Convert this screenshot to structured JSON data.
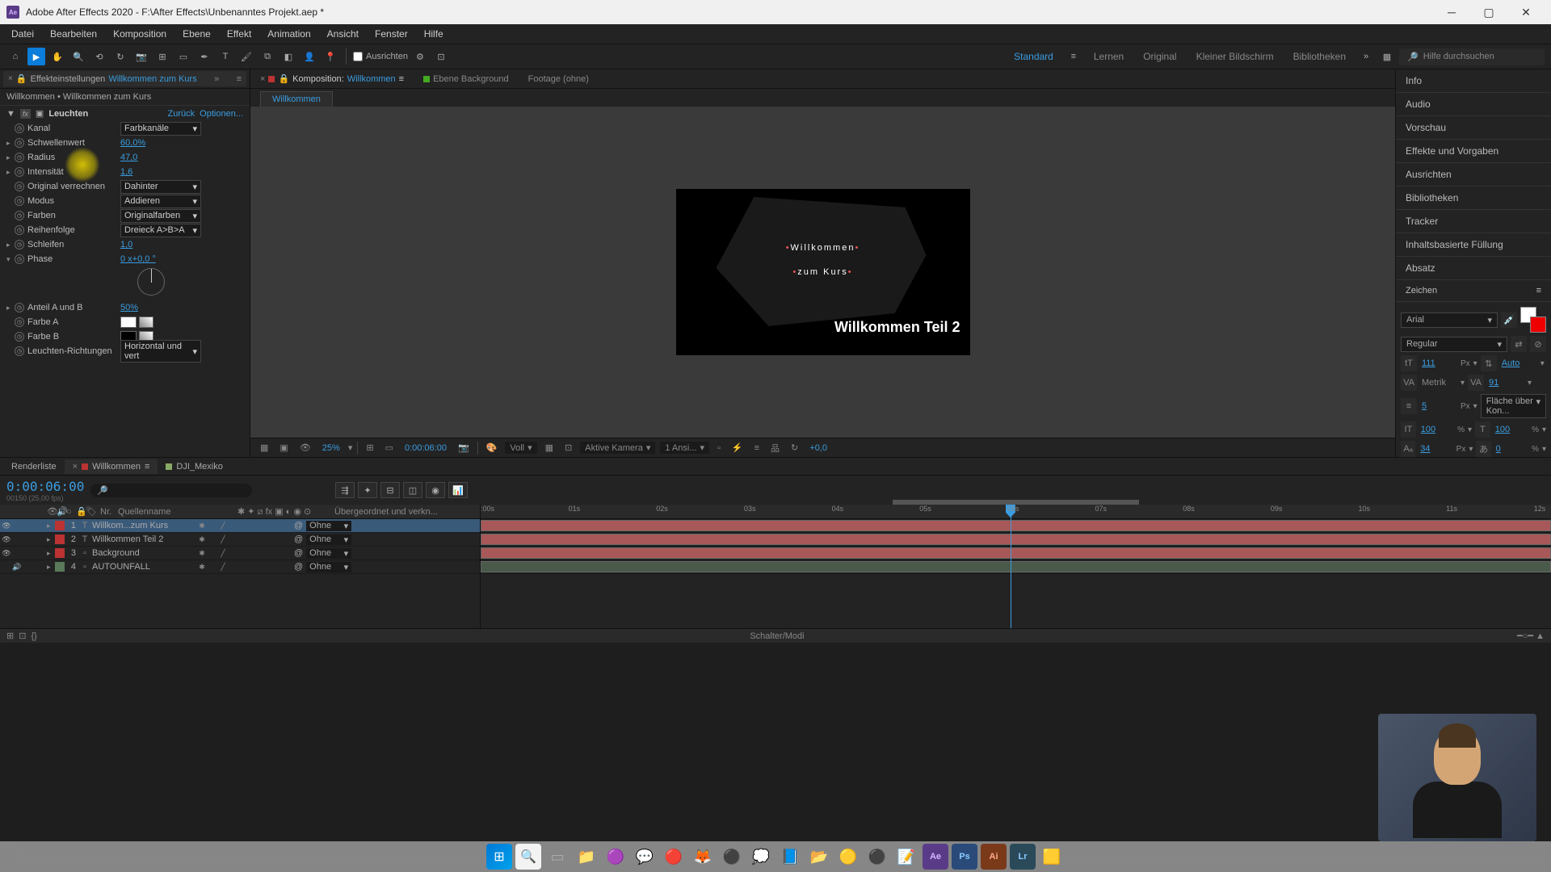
{
  "window": {
    "title": "Adobe After Effects 2020 - F:\\After Effects\\Unbenanntes Projekt.aep *"
  },
  "menu": [
    "Datei",
    "Bearbeiten",
    "Komposition",
    "Ebene",
    "Effekt",
    "Animation",
    "Ansicht",
    "Fenster",
    "Hilfe"
  ],
  "toolbar": {
    "align_label": "Ausrichten",
    "search_placeholder": "Hilfe durchsuchen"
  },
  "workspaces": [
    "Standard",
    "Lernen",
    "Original",
    "Kleiner Bildschirm",
    "Bibliotheken"
  ],
  "effect_panel": {
    "tab_label": "Effekteinstellungen",
    "tab_layer": "Willkommen zum Kurs",
    "subtitle": "Willkommen • Willkommen zum Kurs",
    "effect_name": "Leuchten",
    "back_label": "Zurück",
    "options_label": "Optionen...",
    "props": {
      "kanal": {
        "label": "Kanal",
        "value": "Farbkanäle"
      },
      "schwellenwert": {
        "label": "Schwellenwert",
        "value": "60,0%"
      },
      "radius": {
        "label": "Radius",
        "value": "47,0"
      },
      "intensitat": {
        "label": "Intensität",
        "value": "1,6"
      },
      "original": {
        "label": "Original verrechnen",
        "value": "Dahinter"
      },
      "modus": {
        "label": "Modus",
        "value": "Addieren"
      },
      "farben": {
        "label": "Farben",
        "value": "Originalfarben"
      },
      "reihenfolge": {
        "label": "Reihenfolge",
        "value": "Dreieck A>B>A"
      },
      "schleifen": {
        "label": "Schleifen",
        "value": "1,0"
      },
      "phase": {
        "label": "Phase",
        "value": "0 x+0,0 °"
      },
      "anteil": {
        "label": "Anteil A und B",
        "value": "50%"
      },
      "farbe_a": {
        "label": "Farbe A"
      },
      "farbe_b": {
        "label": "Farbe B"
      },
      "richtungen": {
        "label": "Leuchten-Richtungen",
        "value": "Horizontal und vert"
      }
    }
  },
  "comp_panel": {
    "tab1_pre": "Komposition:",
    "tab1_name": "Willkommen",
    "tab2": "Ebene Background",
    "tab3": "Footage (ohne)",
    "subtab": "Willkommen",
    "text1_line1": "Willkommen",
    "text1_line2": "zum Kurs",
    "text2": "Willkommen Teil 2"
  },
  "viewer_controls": {
    "zoom": "25%",
    "timecode": "0:00:06:00",
    "view_mode": "Voll",
    "camera": "Aktive Kamera",
    "views": "1 Ansi...",
    "exposure": "+0,0"
  },
  "right_panels": {
    "info": "Info",
    "audio": "Audio",
    "vorschau": "Vorschau",
    "effekte": "Effekte und Vorgaben",
    "ausrichten": "Ausrichten",
    "bibliotheken": "Bibliotheken",
    "tracker": "Tracker",
    "inhalt": "Inhaltsbasierte Füllung",
    "absatz": "Absatz",
    "zeichen": "Zeichen"
  },
  "character": {
    "font": "Arial",
    "style": "Regular",
    "size": "111",
    "size_unit": "Px",
    "leading": "Auto",
    "kerning": "Metrik",
    "tracking": "91",
    "stroke": "5",
    "stroke_unit": "Px",
    "fill_option": "Fläche über Kon...",
    "vscale": "100",
    "hscale": "100",
    "baseline": "34",
    "baseline_unit": "Px",
    "tsume": "0"
  },
  "timeline": {
    "tabs": {
      "render": "Renderliste",
      "comp1": "Willkommen",
      "comp2": "DJI_Mexiko"
    },
    "timecode": "0:00:06:00",
    "framerate": "00150 (25,00 fps)",
    "col_nr": "Nr.",
    "col_name": "Quellenname",
    "col_parent": "Übergeordnet und verkn...",
    "footer_mid": "Schalter/Modi",
    "parent_none": "Ohne",
    "layers": [
      {
        "nr": "1",
        "type": "T",
        "name": "Willkom...zum Kurs",
        "color": "#b33"
      },
      {
        "nr": "2",
        "type": "T",
        "name": "Willkommen Teil 2",
        "color": "#b33"
      },
      {
        "nr": "3",
        "type": "",
        "name": "Background",
        "color": "#b33"
      },
      {
        "nr": "4",
        "type": "",
        "name": "AUTOUNFALL",
        "color": "#5a7a5a"
      }
    ],
    "ruler_ticks": [
      ":00s",
      "01s",
      "02s",
      "03s",
      "04s",
      "05s",
      "06s",
      "07s",
      "08s",
      "09s",
      "10s",
      "11s",
      "12s"
    ]
  }
}
